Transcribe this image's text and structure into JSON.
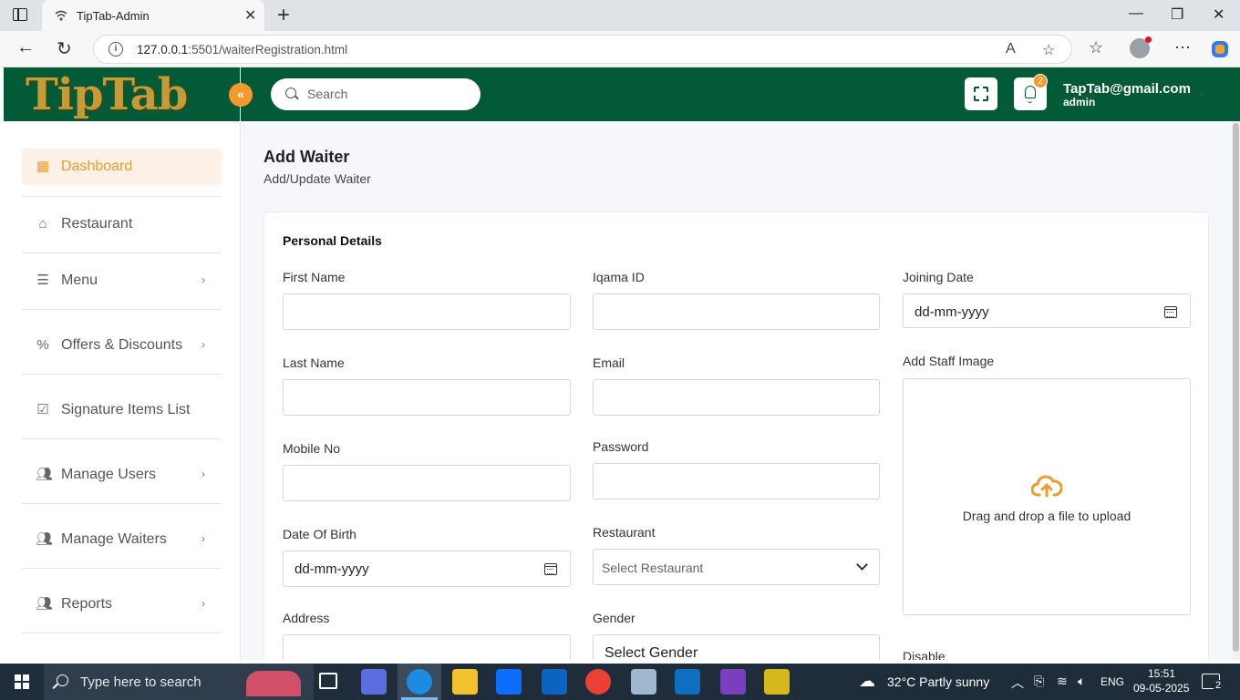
{
  "browser": {
    "tab_title": "TipTab-Admin",
    "url_host": "127.0.0.1",
    "url_rest": ":5501/waiterRegistration.html"
  },
  "header": {
    "logo_text": "TipTab",
    "search_placeholder": "Search",
    "notification_count": "2",
    "user_email": "TapTab@gmail.com",
    "user_role": "admin",
    "colors": {
      "primary": "#035a36",
      "accent": "#f39a2a"
    }
  },
  "sidebar": {
    "items": [
      {
        "label": "Dashboard",
        "icon": "grid-icon",
        "active": true
      },
      {
        "label": "Restaurant",
        "icon": "home-icon"
      },
      {
        "label": "Menu",
        "icon": "list-icon"
      },
      {
        "label": "Offers & Discounts",
        "icon": "percent-icon"
      },
      {
        "label": "Signature Items List",
        "icon": "checkbox-icon"
      },
      {
        "label": "Manage Users",
        "icon": "users-icon"
      },
      {
        "label": "Manage Waiters",
        "icon": "users-icon"
      },
      {
        "label": "Reports",
        "icon": "users-icon"
      }
    ]
  },
  "page": {
    "title": "Add Waiter",
    "subtitle": "Add/Update Waiter",
    "section_title": "Personal Details"
  },
  "form": {
    "first_name_label": "First Name",
    "last_name_label": "Last Name",
    "mobile_label": "Mobile No",
    "dob_label": "Date Of Birth",
    "dob_value": "dd-mm-yyyy",
    "address_label": "Address",
    "iqama_label": "Iqama ID",
    "email_label": "Email",
    "password_label": "Password",
    "restaurant_label": "Restaurant",
    "restaurant_value": "Select Restaurant",
    "gender_label": "Gender",
    "gender_value": "Select Gender",
    "joining_label": "Joining Date",
    "joining_value": "dd-mm-yyyy",
    "staff_image_label": "Add Staff Image",
    "drop_text": "Drag and drop a file to upload",
    "disable_label": "Disable"
  },
  "taskbar": {
    "search_text": "Type here to search",
    "weather": "32°C  Partly sunny",
    "language": "ENG",
    "time": "15:51",
    "date": "09-05-2025",
    "notifications": "2"
  }
}
